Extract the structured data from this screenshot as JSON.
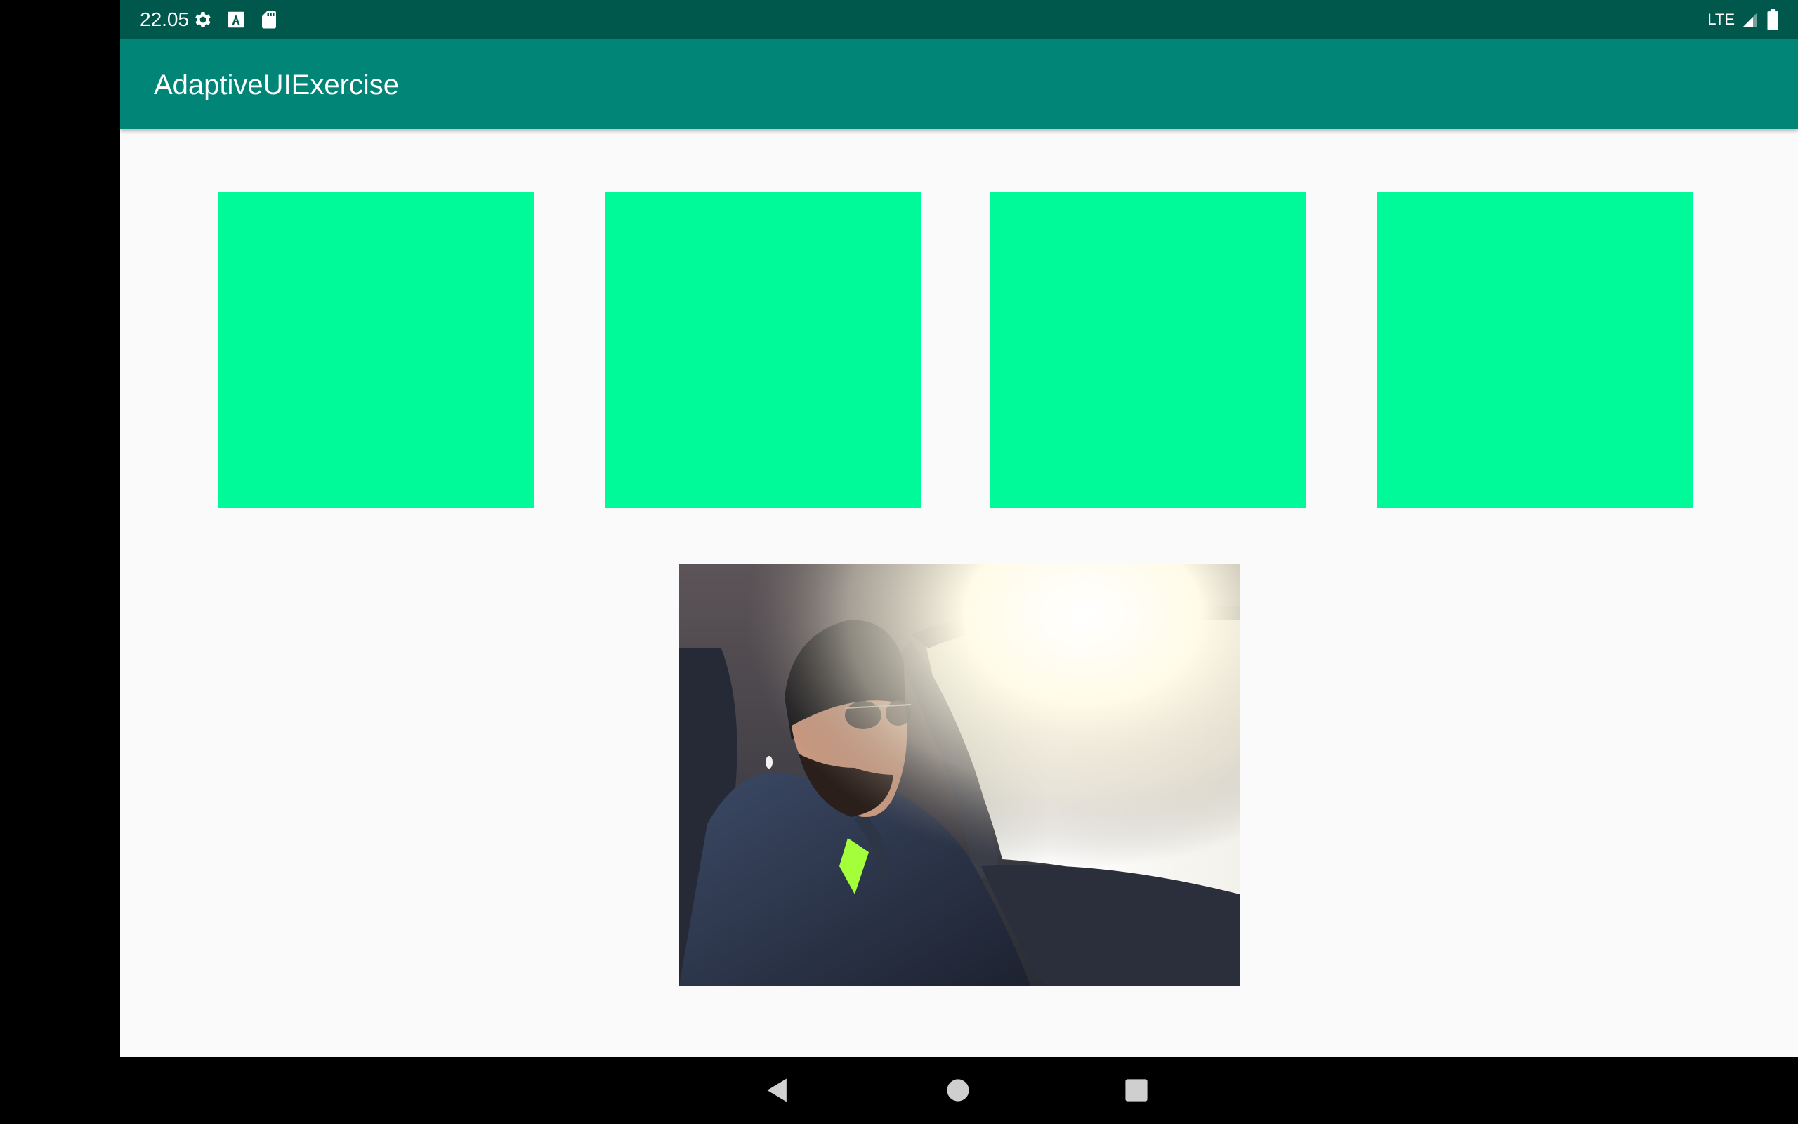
{
  "status_bar": {
    "time": "22.05",
    "icons": [
      "settings-icon",
      "font-a-icon",
      "sd-card-icon"
    ],
    "network_label": "LTE",
    "right_icons": [
      "signal-icon",
      "battery-icon"
    ],
    "color": "#00574b"
  },
  "app_bar": {
    "title": "AdaptiveUIExercise",
    "color": "#008577"
  },
  "content": {
    "background": "#fafafa",
    "boxes": [
      {
        "color": "#00fa9a"
      },
      {
        "color": "#00fa9a"
      },
      {
        "color": "#00fa9a"
      },
      {
        "color": "#00fa9a"
      }
    ],
    "photo": {
      "subject": "man-driving-car-photo"
    }
  },
  "nav_bar": {
    "buttons": [
      "back-icon",
      "home-icon",
      "recents-icon"
    ]
  }
}
